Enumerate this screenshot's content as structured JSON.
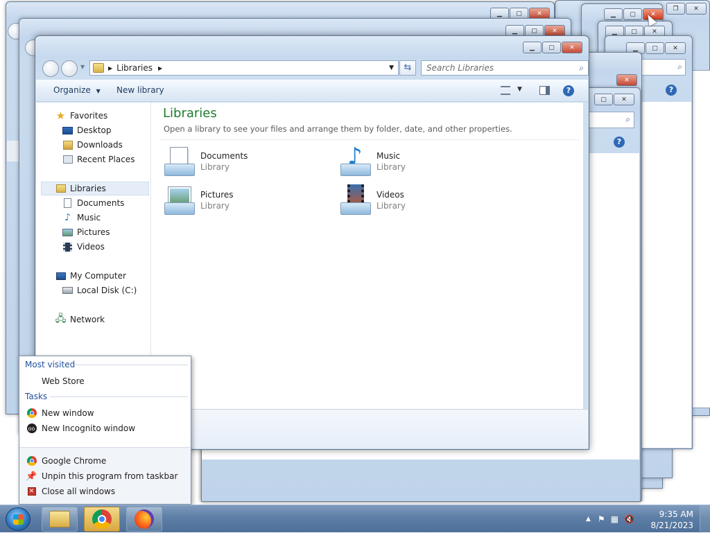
{
  "explorer": {
    "address_crumb": "Libraries",
    "search_placeholder": "Search Libraries",
    "toolbar": {
      "organize": "Organize",
      "new_library": "New library"
    },
    "nav": {
      "favorites": "Favorites",
      "favorites_items": [
        "Desktop",
        "Downloads",
        "Recent Places"
      ],
      "libraries": "Libraries",
      "libraries_items": [
        "Documents",
        "Music",
        "Pictures",
        "Videos"
      ],
      "computer": "My Computer",
      "computer_items": [
        "Local Disk (C:)"
      ],
      "network": "Network"
    },
    "content": {
      "title": "Libraries",
      "subtitle": "Open a library to see your files and arrange them by folder, date, and other properties.",
      "libraries": [
        {
          "name": "Documents",
          "type": "Library",
          "icon": "documents-library-icon"
        },
        {
          "name": "Music",
          "type": "Library",
          "icon": "music-library-icon"
        },
        {
          "name": "Pictures",
          "type": "Library",
          "icon": "pictures-library-icon"
        },
        {
          "name": "Videos",
          "type": "Library",
          "icon": "videos-library-icon"
        }
      ]
    }
  },
  "jumplist": {
    "most_visited_heading": "Most visited",
    "most_visited": [
      "Web Store"
    ],
    "tasks_heading": "Tasks",
    "tasks": [
      "New window",
      "New Incognito window"
    ],
    "app_items": [
      "Google Chrome",
      "Unpin this program from taskbar",
      "Close all windows"
    ]
  },
  "taskbar": {
    "time": "9:35 AM",
    "date": "8/21/2023",
    "pinned": [
      "file-explorer-icon",
      "chrome-icon",
      "firefox-icon"
    ],
    "active_item": "chrome-icon"
  },
  "colors": {
    "title_green": "#1e7c2b",
    "link_blue": "#1e4f9c",
    "close_red": "#c74a37",
    "taskbar_blue": "#5d7ea5"
  }
}
